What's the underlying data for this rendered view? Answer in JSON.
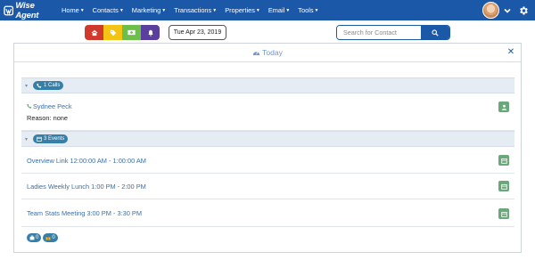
{
  "navbar": {
    "brand": "Wise Agent",
    "items": [
      {
        "label": "Home"
      },
      {
        "label": "Contacts"
      },
      {
        "label": "Marketing"
      },
      {
        "label": "Transactions"
      },
      {
        "label": "Properties"
      },
      {
        "label": "Email"
      },
      {
        "label": "Tools"
      }
    ],
    "bg_color": "#1c58a8"
  },
  "toolbar": {
    "quick_buttons": [
      {
        "icon": "house-icon",
        "color": "#d0392b"
      },
      {
        "icon": "tag-icon",
        "color": "#f3c413"
      },
      {
        "icon": "money-icon",
        "color": "#6cbf4a"
      },
      {
        "icon": "bell-icon",
        "color": "#5a3f9e"
      }
    ],
    "date": "Tue Apr 23, 2019",
    "search_placeholder": "Search for Contact"
  },
  "panel": {
    "title": "Today",
    "calls": {
      "badge": "1 Calls",
      "items": [
        {
          "name": "Sydnee Peck",
          "reason": "Reason: none"
        }
      ]
    },
    "events": {
      "badge": "3 Events",
      "items": [
        {
          "label": "Overview Link 12:00:00 AM - 1:00:00 AM"
        },
        {
          "label": "Ladies Weekly Lunch 1:00 PM - 2:00 PM"
        },
        {
          "label": "Team Stats Meeting 3:00 PM - 3:30 PM"
        }
      ]
    },
    "footer": {
      "badge1_count": "0",
      "badge2_count": "0"
    }
  }
}
